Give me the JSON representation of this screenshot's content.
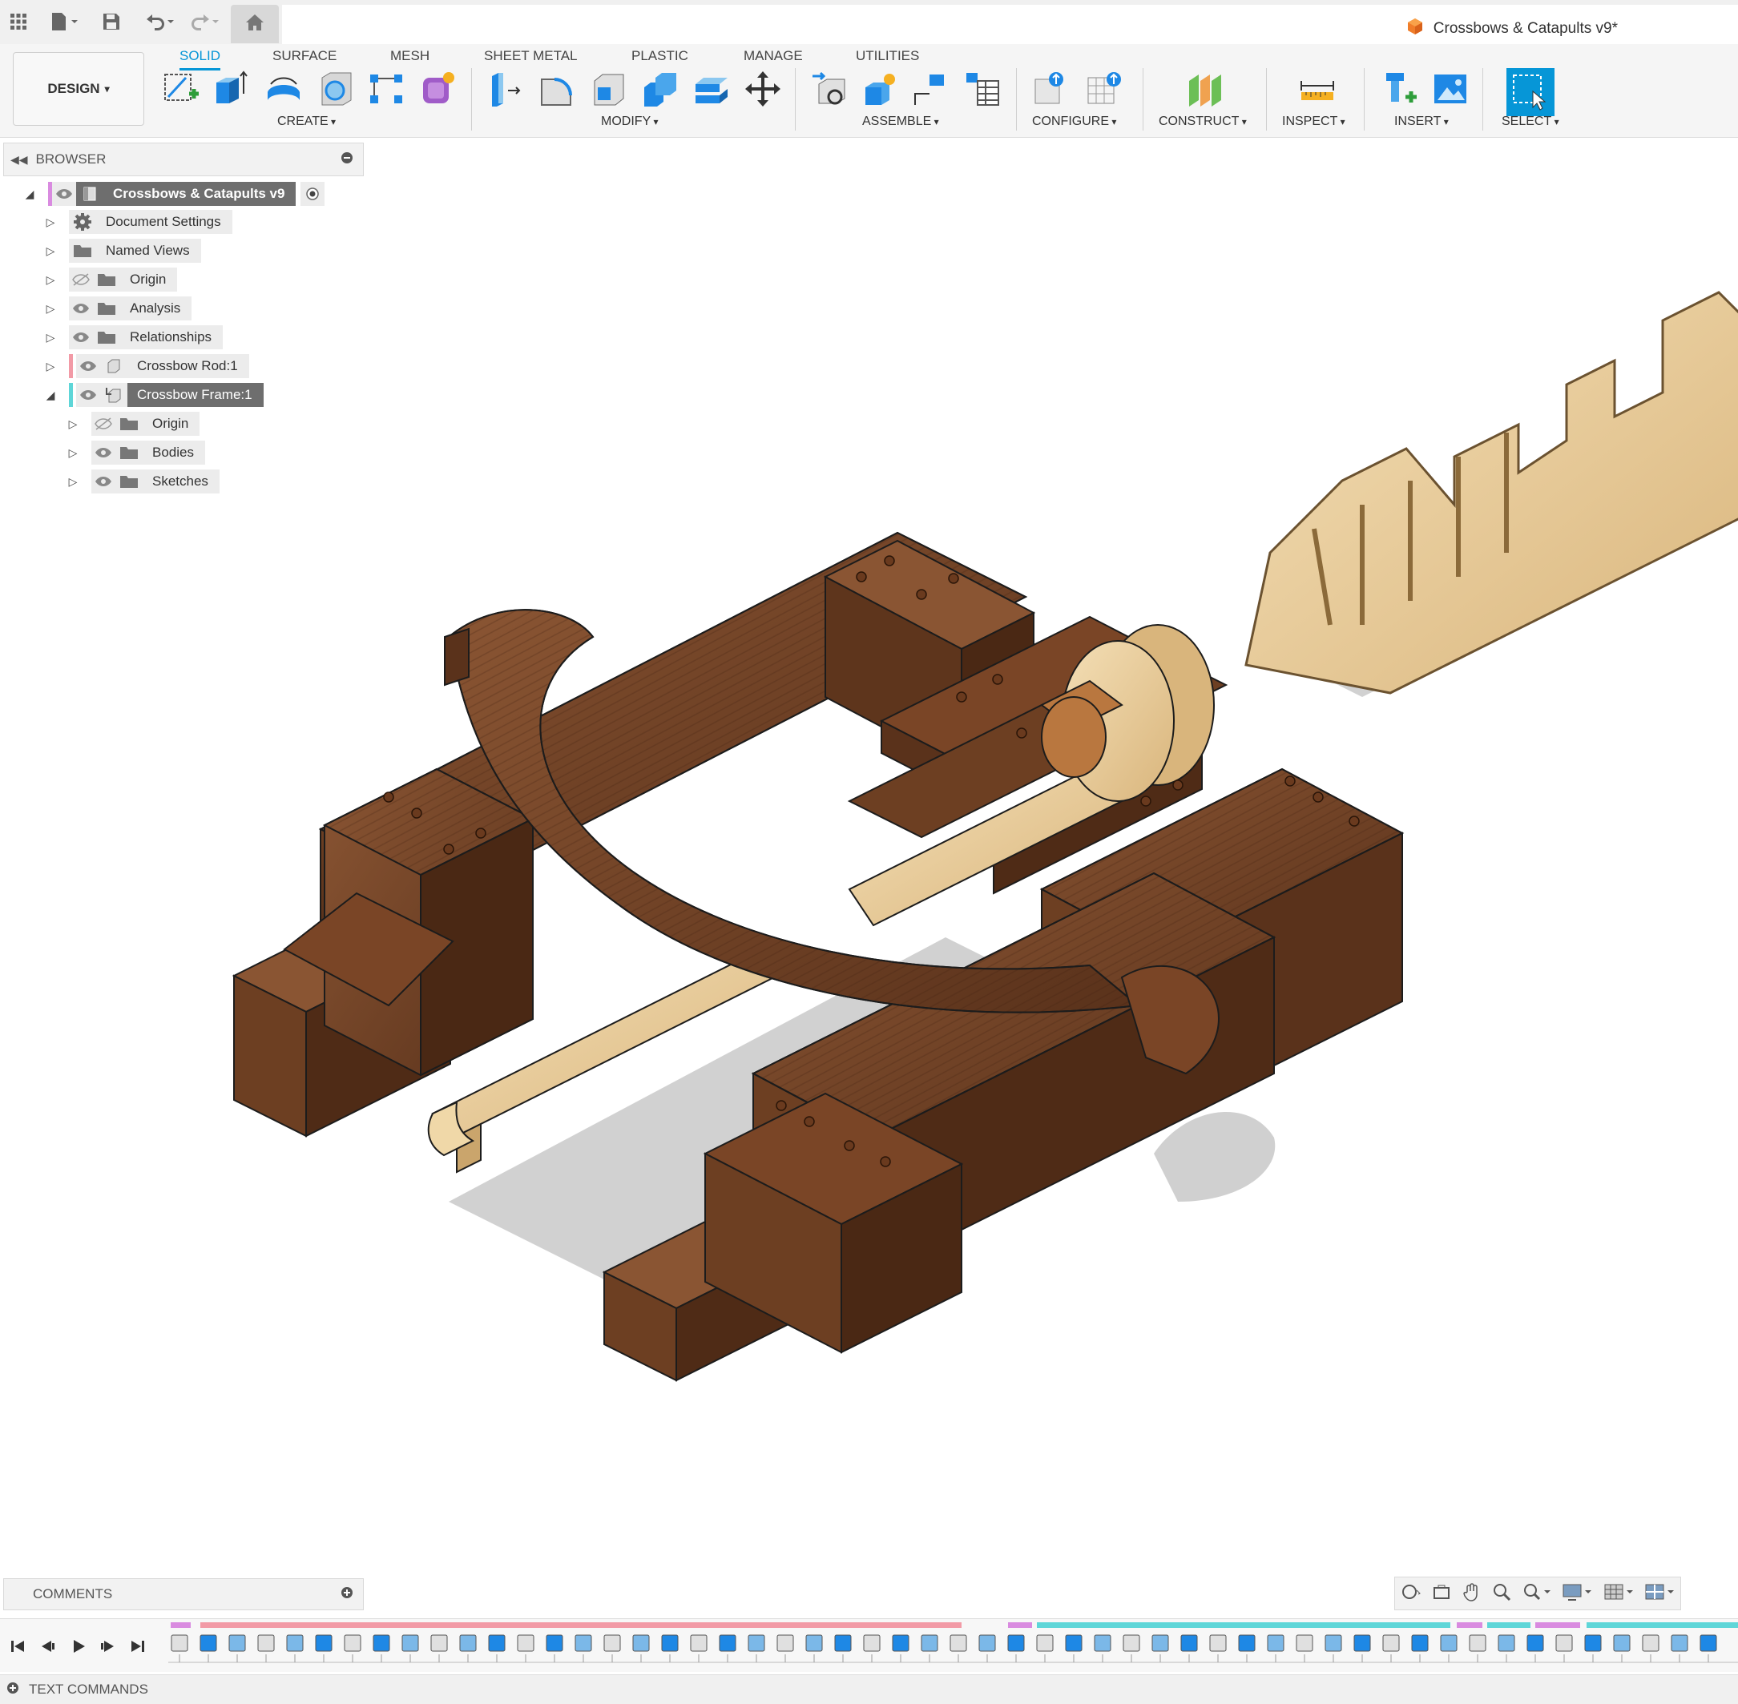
{
  "document": {
    "title": "Crossbows & Catapults v9*"
  },
  "ribbon": {
    "workspace": "DESIGN",
    "tabs": [
      "SOLID",
      "SURFACE",
      "MESH",
      "SHEET METAL",
      "PLASTIC",
      "MANAGE",
      "UTILITIES"
    ],
    "active_tab": "SOLID",
    "groups": [
      "CREATE",
      "MODIFY",
      "ASSEMBLE",
      "CONFIGURE",
      "CONSTRUCT",
      "INSPECT",
      "INSERT",
      "SELECT"
    ]
  },
  "browser": {
    "title": "BROWSER",
    "root": "Crossbows & Catapults v9",
    "items": [
      {
        "label": "Document Settings"
      },
      {
        "label": "Named Views"
      },
      {
        "label": "Origin"
      },
      {
        "label": "Analysis"
      },
      {
        "label": "Relationships"
      },
      {
        "label": "Crossbow Rod:1"
      },
      {
        "label": "Crossbow Frame:1"
      },
      {
        "label": "Origin"
      },
      {
        "label": "Bodies"
      },
      {
        "label": "Sketches"
      }
    ]
  },
  "bottom": {
    "comments": "COMMENTS",
    "text_commands": "TEXT COMMANDS"
  },
  "colors": {
    "accent": "#0696d7",
    "wood_dark": "#7a4a2a",
    "wood_light": "#e9cfa0",
    "component_pink": "#f29aa6",
    "component_cyan": "#5ed6d8",
    "component_magenta": "#d98be0"
  }
}
